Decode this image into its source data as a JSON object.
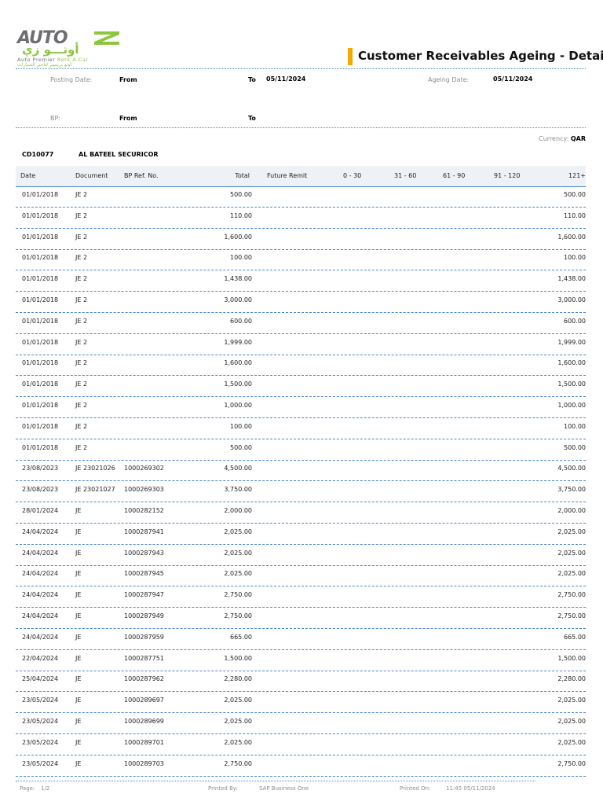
{
  "logo": {
    "latin": "AUTO",
    "arabic": "أوتـــو زي",
    "tagline_en_1": "Auto Premier",
    "tagline_en_2": "Rent A Car",
    "tagline_ar": "أوتو بريميير لتأجير السيارات"
  },
  "colors": {
    "accent": "#f2a900",
    "rule": "#4a86c8",
    "logo_green": "#8cc63f",
    "logo_gray": "#6d6e71"
  },
  "title": "Customer Receivables Ageing - Details",
  "filters": {
    "posting_date_label": "Posting Date:",
    "from_label": "From",
    "to_label": "To",
    "posting_to_value": "05/11/2024",
    "ageing_date_label": "Ageing Date:",
    "ageing_date_value": "05/11/2024",
    "bp_label": "BP:",
    "bp_from_label": "From",
    "bp_to_label": "To",
    "currency_label": "Currency:",
    "currency_value": "QAR"
  },
  "customer": {
    "code": "CD10077",
    "name": "AL BATEEL SECURICOR"
  },
  "columns": [
    "Date",
    "Document",
    "BP Ref. No.",
    "Total",
    "Future Remit",
    "0 - 30",
    "31 - 60",
    "61 - 90",
    "91 - 120",
    "121+"
  ],
  "rows": [
    {
      "date": "01/01/2018",
      "doc": "JE 2",
      "ref": "",
      "total": "500.00",
      "d121": "500.00"
    },
    {
      "date": "01/01/2018",
      "doc": "JE 2",
      "ref": "",
      "total": "110.00",
      "d121": "110.00"
    },
    {
      "date": "01/01/2018",
      "doc": "JE 2",
      "ref": "",
      "total": "1,600.00",
      "d121": "1,600.00"
    },
    {
      "date": "01/01/2018",
      "doc": "JE 2",
      "ref": "",
      "total": "100.00",
      "d121": "100.00"
    },
    {
      "date": "01/01/2018",
      "doc": "JE 2",
      "ref": "",
      "total": "1,438.00",
      "d121": "1,438.00"
    },
    {
      "date": "01/01/2018",
      "doc": "JE 2",
      "ref": "",
      "total": "3,000.00",
      "d121": "3,000.00"
    },
    {
      "date": "01/01/2018",
      "doc": "JE 2",
      "ref": "",
      "total": "600.00",
      "d121": "600.00"
    },
    {
      "date": "01/01/2018",
      "doc": "JE 2",
      "ref": "",
      "total": "1,999.00",
      "d121": "1,999.00"
    },
    {
      "date": "01/01/2018",
      "doc": "JE 2",
      "ref": "",
      "total": "1,600.00",
      "d121": "1,600.00"
    },
    {
      "date": "01/01/2018",
      "doc": "JE 2",
      "ref": "",
      "total": "1,500.00",
      "d121": "1,500.00"
    },
    {
      "date": "01/01/2018",
      "doc": "JE 2",
      "ref": "",
      "total": "1,000.00",
      "d121": "1,000.00"
    },
    {
      "date": "01/01/2018",
      "doc": "JE 2",
      "ref": "",
      "total": "100.00",
      "d121": "100.00"
    },
    {
      "date": "01/01/2018",
      "doc": "JE 2",
      "ref": "",
      "total": "500.00",
      "d121": "500.00"
    },
    {
      "date": "23/08/2023",
      "doc": "JE 23021026",
      "ref": "1000269302",
      "total": "4,500.00",
      "d121": "4,500.00"
    },
    {
      "date": "23/08/2023",
      "doc": "JE 23021027",
      "ref": "1000269303",
      "total": "3,750.00",
      "d121": "3,750.00"
    },
    {
      "date": "28/01/2024",
      "doc": "JE",
      "ref": "1000282152",
      "total": "2,000.00",
      "d121": "2,000.00"
    },
    {
      "date": "24/04/2024",
      "doc": "JE",
      "ref": "1000287941",
      "total": "2,025.00",
      "d121": "2,025.00"
    },
    {
      "date": "24/04/2024",
      "doc": "JE",
      "ref": "1000287943",
      "total": "2,025.00",
      "d121": "2,025.00"
    },
    {
      "date": "24/04/2024",
      "doc": "JE",
      "ref": "1000287945",
      "total": "2,025.00",
      "d121": "2,025.00"
    },
    {
      "date": "24/04/2024",
      "doc": "JE",
      "ref": "1000287947",
      "total": "2,750.00",
      "d121": "2,750.00"
    },
    {
      "date": "24/04/2024",
      "doc": "JE",
      "ref": "1000287949",
      "total": "2,750.00",
      "d121": "2,750.00"
    },
    {
      "date": "24/04/2024",
      "doc": "JE",
      "ref": "1000287959",
      "total": "665.00",
      "d121": "665.00"
    },
    {
      "date": "22/04/2024",
      "doc": "JE",
      "ref": "1000287751",
      "total": "1,500.00",
      "d121": "1,500.00"
    },
    {
      "date": "25/04/2024",
      "doc": "JE",
      "ref": "1000287962",
      "total": "2,280.00",
      "d121": "2,280.00"
    },
    {
      "date": "23/05/2024",
      "doc": "JE",
      "ref": "1000289697",
      "total": "2,025.00",
      "d121": "2,025.00"
    },
    {
      "date": "23/05/2024",
      "doc": "JE",
      "ref": "1000289699",
      "total": "2,025.00",
      "d121": "2,025.00"
    },
    {
      "date": "23/05/2024",
      "doc": "JE",
      "ref": "1000289701",
      "total": "2,025.00",
      "d121": "2,025.00"
    },
    {
      "date": "23/05/2024",
      "doc": "JE",
      "ref": "1000289703",
      "total": "2,750.00",
      "d121": "2,750.00"
    }
  ],
  "footer": {
    "page_label": "Page:",
    "page_value": "1/2",
    "printed_by_label": "Printed By:",
    "printed_by_value": "SAP Business One",
    "printed_on_label": "Printed On:",
    "printed_on_value": "11:45 05/11/2024"
  }
}
